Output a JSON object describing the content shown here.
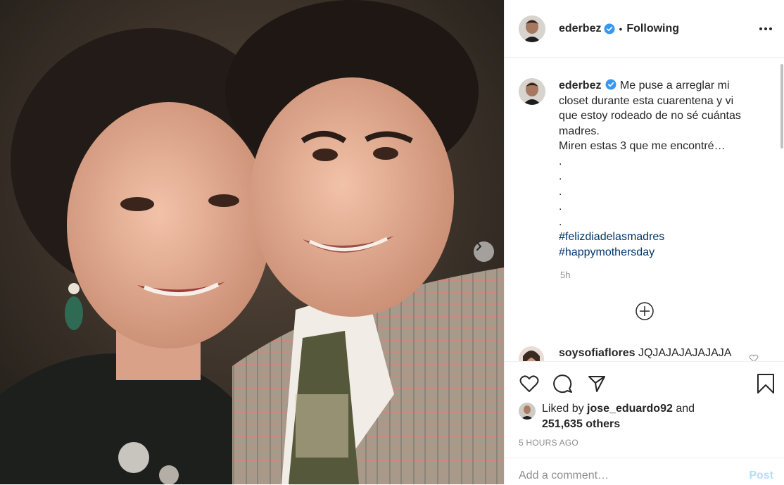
{
  "post": {
    "username": "ederbez",
    "separator": "•",
    "follow_status": "Following",
    "more_options_icon": "more-horizontal-icon",
    "next_photo_icon": "chevron-right-icon",
    "caption": {
      "lines": [
        "Me puse a arreglar mi",
        "closet durante esta cuarentena y vi",
        "que estoy rodeado de no sé cuántas",
        "madres.",
        "Miren estas 3 que me encontré…",
        ".",
        ".",
        ".",
        ".",
        "."
      ],
      "hashtags": [
        "#felizdiadelasmadres",
        "#happymothersday"
      ],
      "time": "5h"
    },
    "comment": {
      "username": "soysofiaflores",
      "text": "JQJAJAJAJAJAJA"
    },
    "likes": {
      "prefix": "Liked by",
      "user": "jose_eduardo92",
      "joiner": "and",
      "others": "251,635 others"
    },
    "posted": "5 HOURS AGO",
    "add_comment_placeholder": "Add a comment…",
    "post_label": "Post"
  },
  "colors": {
    "verified_blue": "#3897f0",
    "hashtag": "#00376b",
    "muted": "#8e8e8e",
    "post_disabled": "#b2dffc"
  }
}
